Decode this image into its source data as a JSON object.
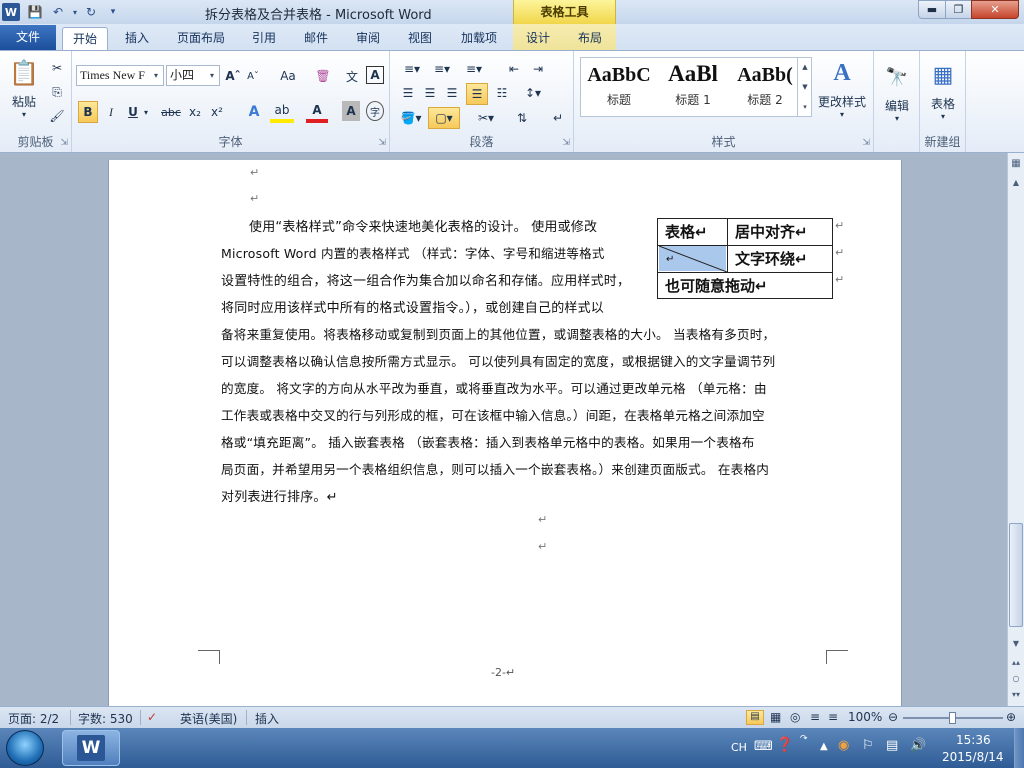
{
  "window": {
    "title": "拆分表格及合并表格 - Microsoft Word",
    "context_tool": "表格工具",
    "app_icon": "W"
  },
  "tabs": [
    "文件",
    "开始",
    "插入",
    "页面布局",
    "引用",
    "邮件",
    "审阅",
    "视图",
    "加载项",
    "设计",
    "布局"
  ],
  "ribbon": {
    "groups": {
      "clipboard": "剪贴板",
      "font": "字体",
      "paragraph": "段落",
      "styles": "样式",
      "new_group": "新建组"
    },
    "paste_label": "粘贴",
    "font_name": "Times New F",
    "font_size": "小四",
    "styles": [
      {
        "sample": "AaBbC",
        "name": "标题"
      },
      {
        "sample": "AaBl",
        "name": "标题 1"
      },
      {
        "sample": "AaBb(",
        "name": "标题 2"
      }
    ],
    "change_styles": "更改样式",
    "edit": "编辑",
    "table": "表格"
  },
  "document": {
    "body_lines": [
      "使用“表格样式”命令来快速地美化表格的设计。 使用或修改",
      "Microsoft Word 内置的表格样式 （样式：字体、字号和缩进等格式",
      "设置特性的组合，将这一组合作为集合加以命名和存储。应用样式时，",
      "将同时应用该样式中所有的格式设置指令。），或创建自己的样式以",
      "备将来重复使用。将表格移动或复制到页面上的其他位置，或调整表格的大小。 当表格有多页时，",
      "可以调整表格以确认信息按所需方式显示。 可以使列具有固定的宽度，或根据键入的文字量调节列",
      "的宽度。  将文字的方向从水平改为垂直，或将垂直改为水平。可以通过更改单元格 （单元格：由",
      "工作表或表格中交叉的行与列形成的框，可在该框中输入信息。）间距，在表格单元格之间添加空",
      "格或“填充距离”。 插入嵌套表格 （嵌套表格：插入到表格单元格中的表格。如果用一个表格布",
      "局页面，并希望用另一个表格组织信息，则可以插入一个嵌套表格。）来创建页面版式。 在表格内",
      "对列表进行排序。↵"
    ],
    "table": {
      "r1c1": "表格↵",
      "r1c2": "居中对齐↵",
      "r2c1": "↵",
      "r2c2": "文字环绕↵",
      "r3": "也可随意拖动↵"
    },
    "para_mark": "↵",
    "page_number": "-2-↵"
  },
  "statusbar": {
    "page": "页面: 2/2",
    "words": "字数: 530",
    "language": "英语(美国)",
    "mode": "插入",
    "zoom": "100%",
    "zoom_level": 1.0
  },
  "taskbar": {
    "ime": "CH",
    "time": "15:36",
    "date": "2015/8/14"
  },
  "colors": {
    "file_tab": "#1c4f9c",
    "context_tools": "#f0d64a",
    "table_cell_fill": "#a9c8ec"
  }
}
